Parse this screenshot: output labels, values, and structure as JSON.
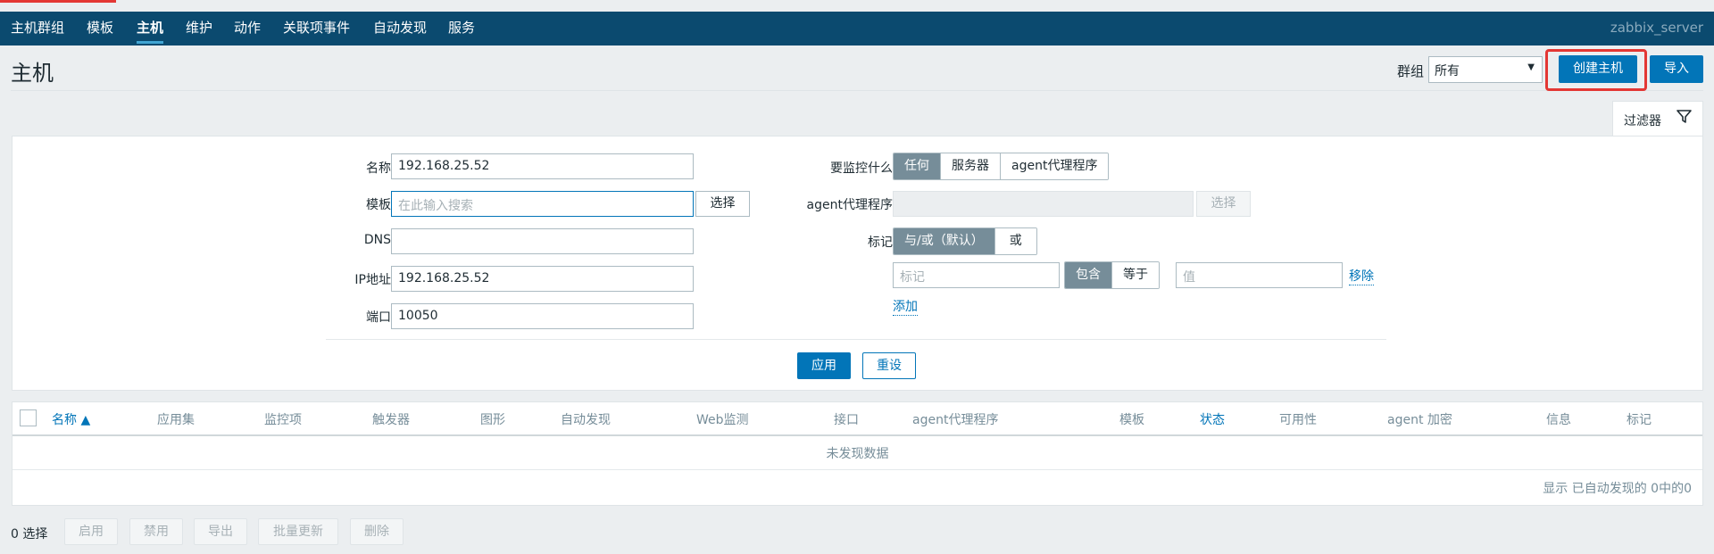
{
  "nav": {
    "items": [
      "主机群组",
      "模板",
      "主机",
      "维护",
      "动作",
      "关联项事件",
      "自动发现",
      "服务"
    ],
    "active": "主机",
    "server_name": "zabbix_server"
  },
  "page": {
    "title": "主机"
  },
  "header_controls": {
    "group_label": "群组",
    "group_value": "所有",
    "create_label": "创建主机",
    "import_label": "导入"
  },
  "filter": {
    "tab_label": "过滤器",
    "name_label": "名称",
    "name_value": "192.168.25.52",
    "template_label": "模板",
    "template_placeholder": "在此输入搜索",
    "select_label": "选择",
    "dns_label": "DNS",
    "dns_value": "",
    "ip_label": "IP地址",
    "ip_value": "192.168.25.52",
    "port_label": "端口",
    "port_value": "10050",
    "monitor_label": "要监控什么",
    "monitor_options": [
      "任何",
      "服务器",
      "agent代理程序"
    ],
    "monitor_selected": "任何",
    "proxy_label": "agent代理程序",
    "proxy_select_label": "选择",
    "tags_label": "标记",
    "tags_mode_options": [
      "与/或（默认）",
      "或"
    ],
    "tags_mode_selected": "与/或（默认）",
    "tag_placeholder": "标记",
    "tag_op_options": [
      "包含",
      "等于"
    ],
    "tag_op_selected": "包含",
    "value_placeholder": "值",
    "remove_label": "移除",
    "add_label": "添加",
    "apply_label": "应用",
    "reset_label": "重设"
  },
  "table": {
    "columns": [
      "名称 ▲",
      "应用集",
      "监控项",
      "触发器",
      "图形",
      "自动发现",
      "Web监测",
      "接口",
      "agent代理程序",
      "模板",
      "状态",
      "可用性",
      "agent 加密",
      "信息",
      "标记"
    ],
    "empty_text": "未发现数据",
    "summary": "显示 已自动发现的 0中的0"
  },
  "footer": {
    "selected": "0 选择",
    "actions": [
      "启用",
      "禁用",
      "导出",
      "批量更新",
      "删除"
    ]
  },
  "colors": {
    "nav_bg": "#0b4a6f",
    "primary": "#0275b8",
    "highlight": "#e33734",
    "segment_on": "#768d99"
  }
}
